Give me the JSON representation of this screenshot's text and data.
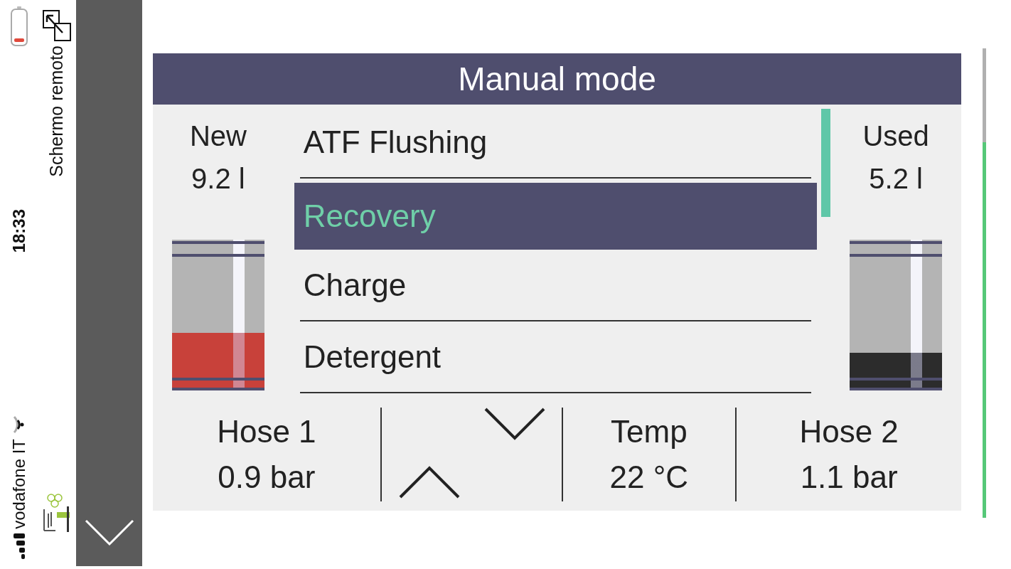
{
  "status_bar": {
    "time": "18:33",
    "carrier": "vodafone IT",
    "app_title": "Schermo remoto"
  },
  "screen": {
    "title": "Manual mode",
    "tanks": [
      {
        "label": "New",
        "reading": "9.2 l",
        "level": 0.38,
        "color": "#c8413a"
      },
      {
        "label": "Used",
        "reading": "5.2 l",
        "level": 0.25,
        "color": "#2c2c2c"
      }
    ],
    "menu": [
      {
        "label": "ATF Flushing",
        "selected": false
      },
      {
        "label": "Recovery",
        "selected": true
      },
      {
        "label": "Charge",
        "selected": false
      },
      {
        "label": "Detergent",
        "selected": false
      }
    ],
    "gauges": [
      {
        "label": "Hose 1",
        "reading": "0.9 bar"
      },
      {
        "label": "Temp",
        "reading": "22 °C"
      },
      {
        "label": "Hose 2",
        "reading": "1.1 bar"
      }
    ]
  }
}
